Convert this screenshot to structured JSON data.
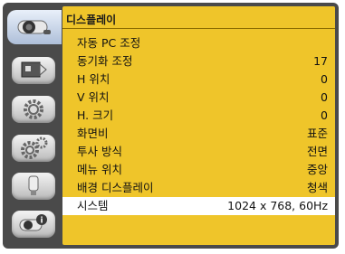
{
  "menu": {
    "title": "디스플레이",
    "items": [
      {
        "label": "자동 PC 조정",
        "value": ""
      },
      {
        "label": "동기화 조정",
        "value": "17"
      },
      {
        "label": "H 위치",
        "value": "0"
      },
      {
        "label": "V 위치",
        "value": "0"
      },
      {
        "label": "H. 크기",
        "value": "0"
      },
      {
        "label": "화면비",
        "value": "표준"
      },
      {
        "label": "투사 방식",
        "value": "전면"
      },
      {
        "label": "메뉴 위치",
        "value": "중앙"
      },
      {
        "label": "배경 디스플레이",
        "value": "청색"
      },
      {
        "label": "시스템",
        "value": "1024 x 768, 60Hz"
      }
    ],
    "selected_index": 9
  },
  "sidebar": {
    "icons": [
      "display-icon",
      "image-adjust-icon",
      "setting-gear-icon",
      "expand-gears-icon",
      "usb-icon",
      "info-icon"
    ],
    "active_index": 0
  },
  "colors": {
    "panel": "#efc52a",
    "frame": "#4a4a4a",
    "highlight": "#ffffff"
  }
}
